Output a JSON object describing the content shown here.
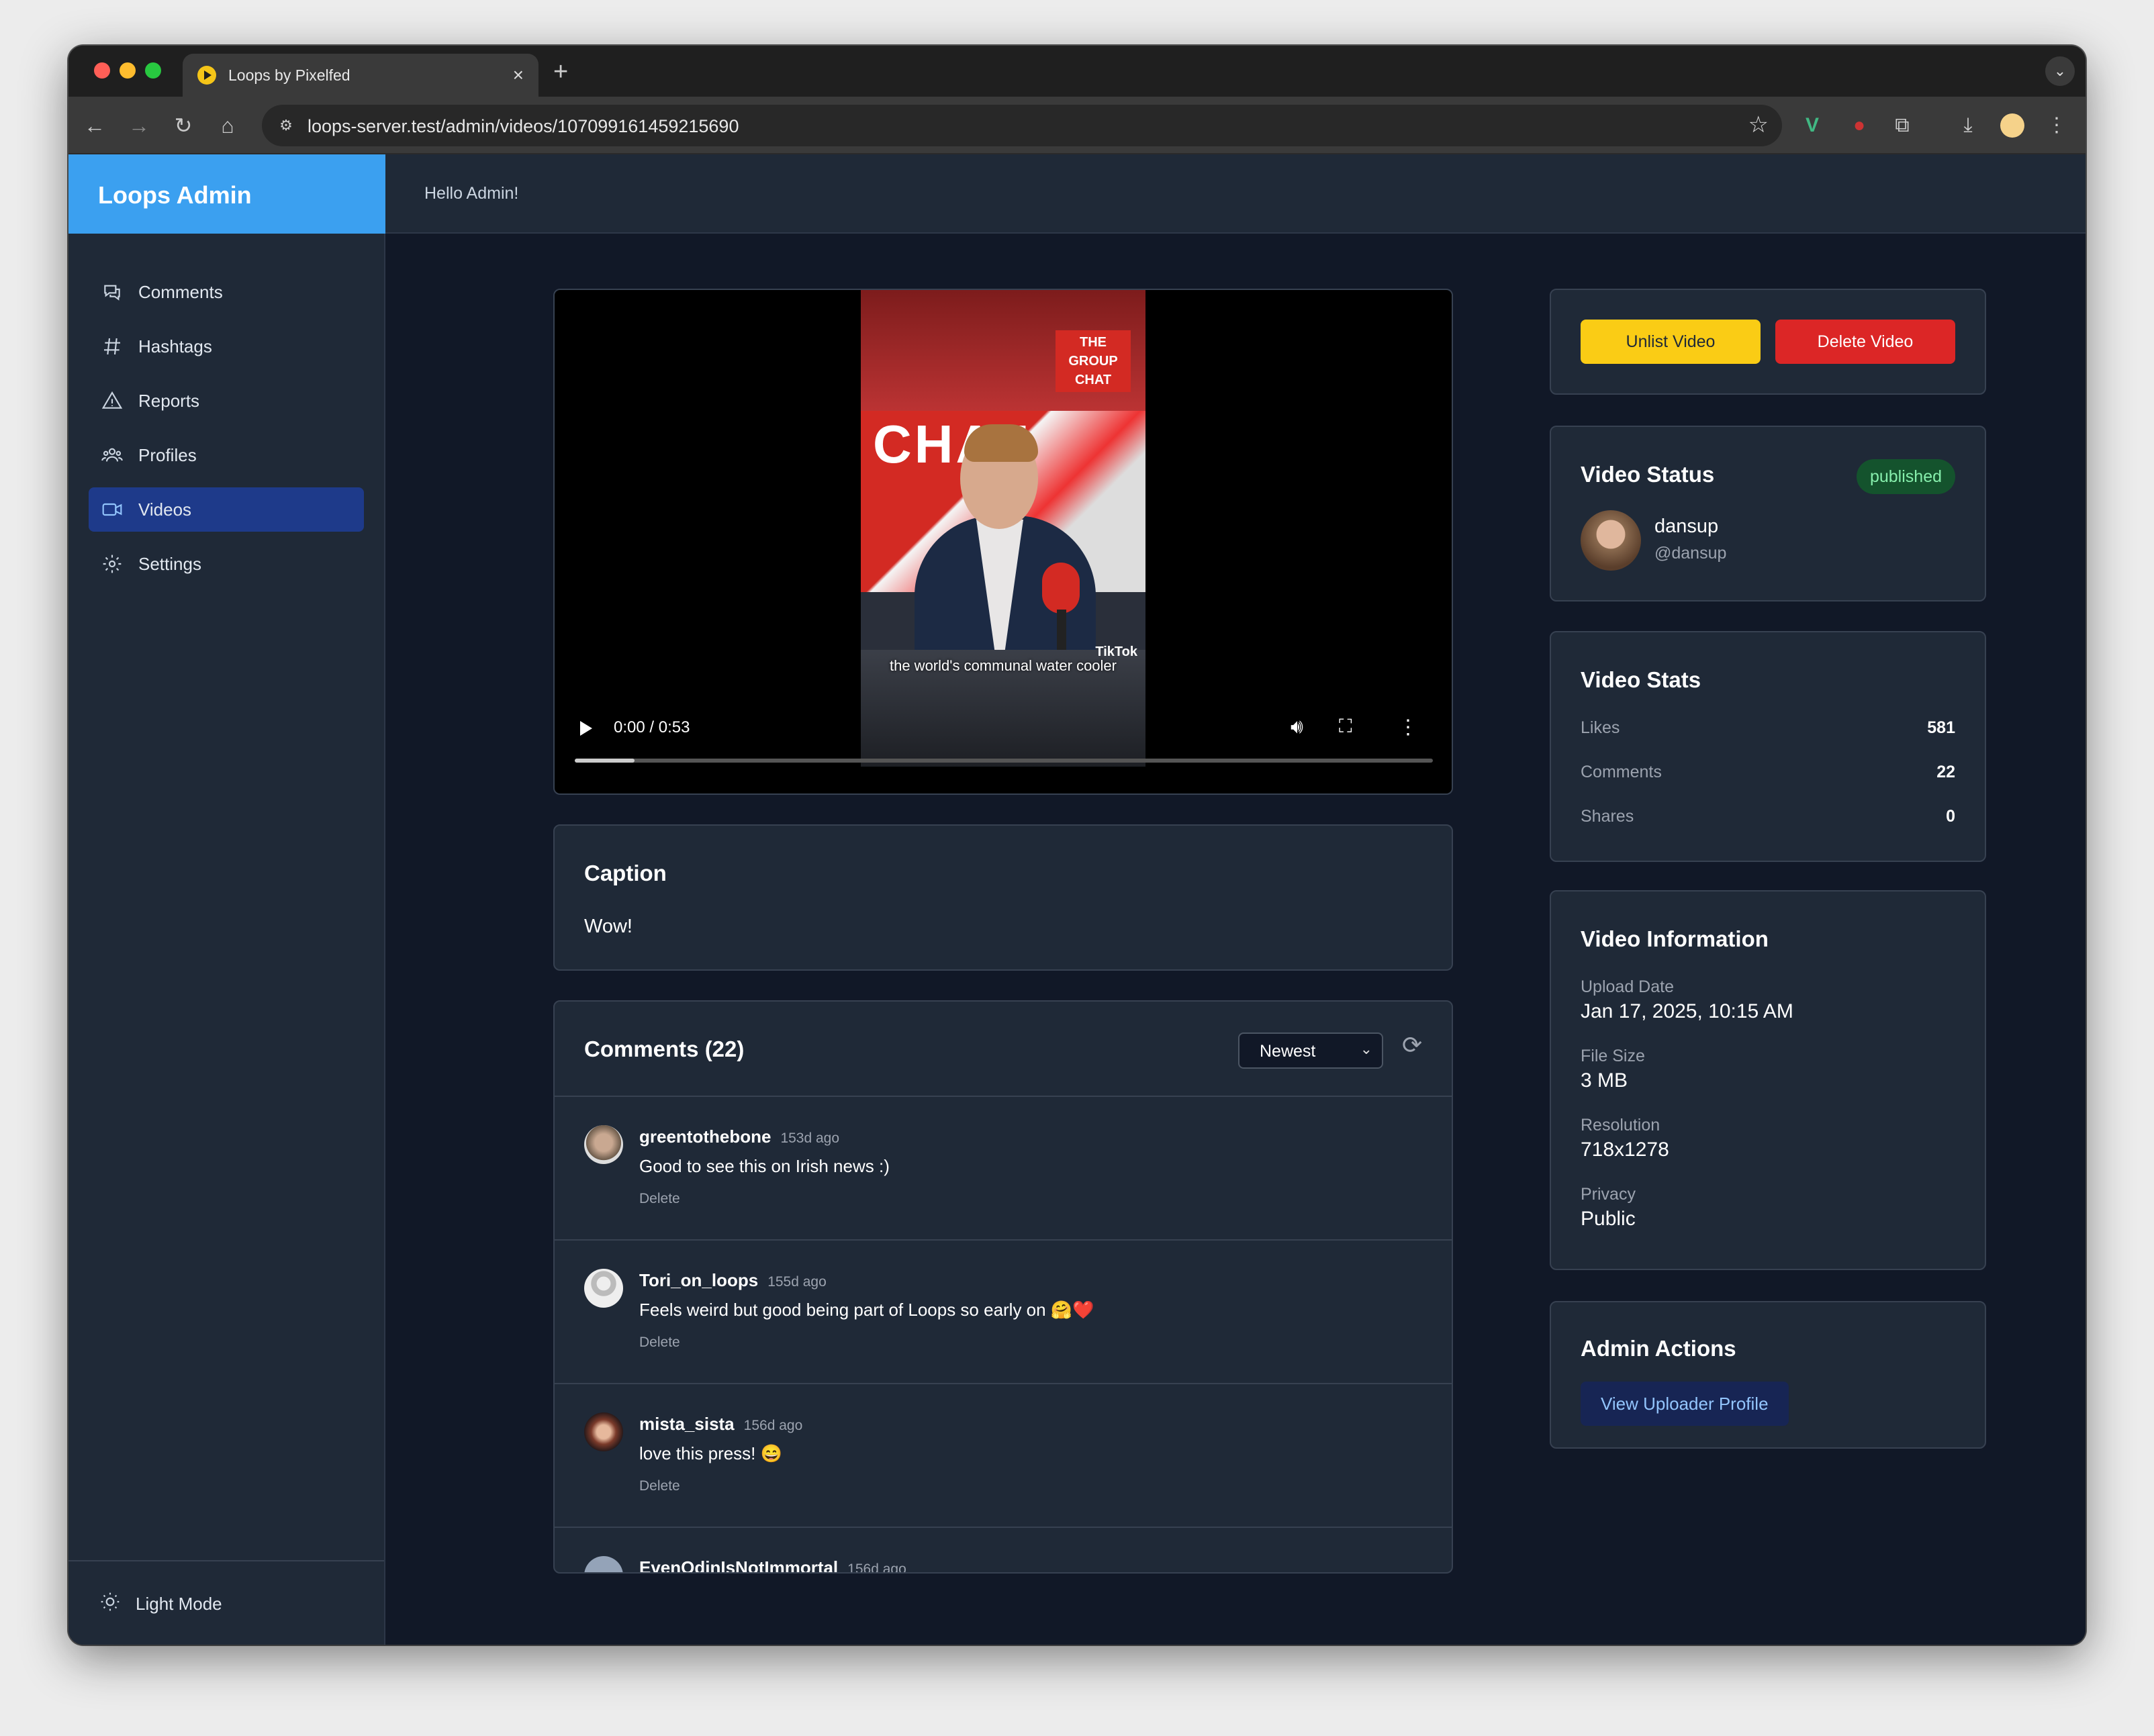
{
  "browser": {
    "tab_title": "Loops by Pixelfed",
    "url": "loops-server.test/admin/videos/107099161459215690"
  },
  "brand": "Loops Admin",
  "greeting": "Hello Admin!",
  "sidebar": {
    "items": [
      {
        "label": "Comments",
        "icon": "comment-icon"
      },
      {
        "label": "Hashtags",
        "icon": "hashtag-icon"
      },
      {
        "label": "Reports",
        "icon": "warning-icon"
      },
      {
        "label": "Profiles",
        "icon": "users-icon"
      },
      {
        "label": "Videos",
        "icon": "video-icon",
        "active": true
      },
      {
        "label": "Settings",
        "icon": "gear-icon"
      }
    ],
    "footer": "Light Mode"
  },
  "video": {
    "time": "0:00 / 0:53",
    "progress": 0.07,
    "overlay_logo": [
      "THE",
      "GROUP",
      "CHAT"
    ],
    "overlay_text": "CHAT",
    "subtitle": "the world's communal water cooler",
    "watermark": "TikTok"
  },
  "actions": {
    "unlist": "Unlist Video",
    "delete": "Delete Video"
  },
  "status": {
    "title": "Video Status",
    "badge": "published",
    "username": "dansup",
    "handle": "@dansup"
  },
  "stats": {
    "title": "Video Stats",
    "rows": [
      {
        "label": "Likes",
        "value": "581"
      },
      {
        "label": "Comments",
        "value": "22"
      },
      {
        "label": "Shares",
        "value": "0"
      }
    ]
  },
  "info": {
    "title": "Video Information",
    "fields": [
      {
        "label": "Upload Date",
        "value": "Jan 17, 2025, 10:15 AM"
      },
      {
        "label": "File Size",
        "value": "3 MB"
      },
      {
        "label": "Resolution",
        "value": "718x1278"
      },
      {
        "label": "Privacy",
        "value": "Public"
      }
    ]
  },
  "admin": {
    "title": "Admin Actions",
    "view_profile": "View Uploader Profile"
  },
  "caption": {
    "title": "Caption",
    "text": "Wow!"
  },
  "comments": {
    "title": "Comments (22)",
    "sort": "Newest",
    "items": [
      {
        "user": "greentothebone",
        "time": "153d ago",
        "text": "Good to see this on Irish news :)",
        "delete": "Delete"
      },
      {
        "user": "Tori_on_loops",
        "time": "155d ago",
        "text": "Feels weird but good being part of Loops so early on 🤗❤️",
        "delete": "Delete"
      },
      {
        "user": "mista_sista",
        "time": "156d ago",
        "text": "love this press! 😄",
        "delete": "Delete"
      },
      {
        "user": "EvenOdinIsNotImmortal",
        "time": "156d ago"
      }
    ]
  }
}
